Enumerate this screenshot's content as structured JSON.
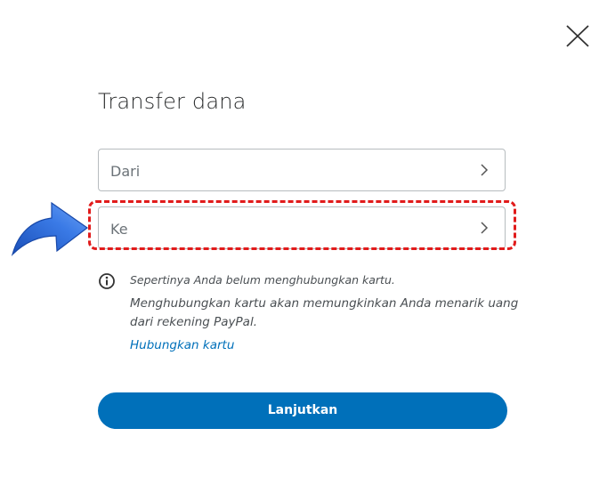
{
  "dialog": {
    "title": "Transfer dana",
    "close_icon": "close-icon"
  },
  "fields": {
    "from_label": "Dari",
    "to_label": "Ke"
  },
  "info": {
    "icon": "info-icon",
    "line1": "Sepertinya Anda belum menghubungkan kartu.",
    "line2": "Menghubungkan kartu akan memungkinkan Anda menarik uang dari rekening PayPal.",
    "link": "Hubungkan kartu"
  },
  "actions": {
    "continue_label": "Lanjutkan"
  },
  "colors": {
    "primary": "#0070ba",
    "highlight": "#e11b1b",
    "arrow": "#1f62d3"
  }
}
